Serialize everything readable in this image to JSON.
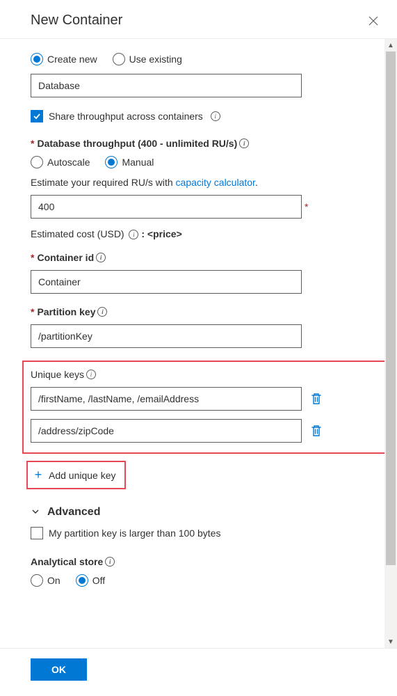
{
  "header": {
    "title": "New Container"
  },
  "db_mode": {
    "create_new": "Create new",
    "use_existing": "Use existing",
    "selected": "create_new"
  },
  "database_name": "Database",
  "share_throughput": {
    "label": "Share throughput across containers",
    "checked": true
  },
  "throughput": {
    "label": "Database throughput (400 - unlimited RU/s)",
    "autoscale": "Autoscale",
    "manual": "Manual",
    "selected": "manual",
    "estimate_prefix": "Estimate your required RU/s with ",
    "estimate_link": "capacity calculator",
    "estimate_suffix": ".",
    "value": "400",
    "cost_prefix": "Estimated cost (USD) ",
    "cost_value": ": <price>"
  },
  "container_id": {
    "label": "Container id",
    "value": "Container"
  },
  "partition_key": {
    "label": "Partition key",
    "value": "/partitionKey"
  },
  "unique_keys": {
    "label": "Unique keys",
    "rows": [
      "/firstName, /lastName, /emailAddress",
      "/address/zipCode"
    ],
    "add_label": "Add unique key"
  },
  "advanced": {
    "label": "Advanced",
    "larger_label": "My partition key is larger than 100 bytes",
    "larger_checked": false
  },
  "analytical": {
    "label": "Analytical store",
    "on": "On",
    "off": "Off",
    "selected": "off"
  },
  "footer": {
    "ok": "OK"
  }
}
